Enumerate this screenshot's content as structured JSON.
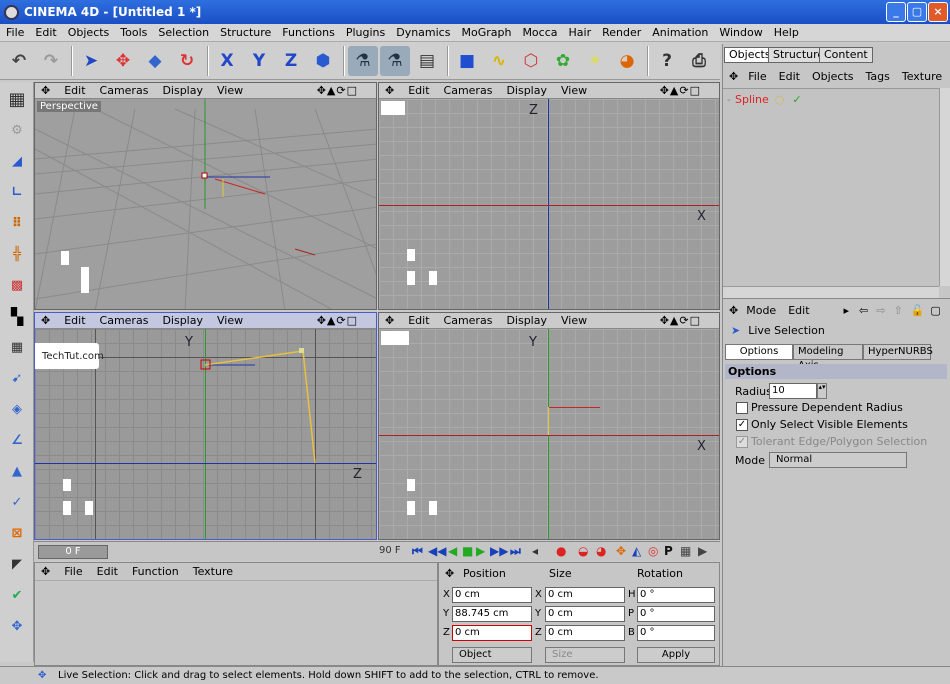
{
  "window": {
    "title": "CINEMA 4D - [Untitled 1 *]",
    "minimize": "_",
    "maximize": "▢",
    "close": "×"
  },
  "menu": [
    "File",
    "Edit",
    "Objects",
    "Tools",
    "Selection",
    "Structure",
    "Functions",
    "Plugins",
    "Dynamics",
    "MoGraph",
    "Mocca",
    "Hair",
    "Render",
    "Animation",
    "Window",
    "Help"
  ],
  "viewport_menu": {
    "edit": "Edit",
    "cameras": "Cameras",
    "display": "Display",
    "view": "View",
    "controls": "✥▲⟳□"
  },
  "viewports": {
    "perspective": {
      "label": "Perspective"
    },
    "top_right": {
      "axis_v": "Z",
      "axis_h": "X"
    },
    "bottom_left": {
      "axis_v": "Y",
      "axis_h": "Z"
    },
    "bottom_right": {
      "axis_v": "Y",
      "axis_h": "X"
    }
  },
  "watermark": "TechTut.com",
  "toolbar_icons": [
    "undo-icon",
    "redo-icon",
    "select-arrow-icon",
    "move-icon",
    "scale-icon",
    "rotate-icon",
    "x-axis-icon",
    "y-axis-icon",
    "z-axis-icon",
    "coordinate-system-icon",
    "model-mode-icon",
    "object-mode-icon",
    "render-settings-icon",
    "cube-icon",
    "spline-icon",
    "nurbs-icon",
    "array-icon",
    "deformer-icon",
    "scene-icon",
    "help-icon",
    "camera-icon"
  ],
  "toolbar_labels": {
    "x": "X",
    "y": "Y",
    "z": "Z"
  },
  "left_tools": [
    "viewport-layout-icon",
    "object-mode-icon",
    "axis-mode-icon",
    "model-mode-icon",
    "points-mode-icon",
    "edges-mode-icon",
    "polygons-mode-icon",
    "texture-mode-icon",
    "workplane-icon",
    "live-select-icon",
    "box-select-icon",
    "freehand-select-icon",
    "polygon-select-icon",
    "brush-icon",
    "magnet-icon",
    "knife-icon",
    "iron-icon",
    "move-tool-icon"
  ],
  "timeline": {
    "start": "0 F",
    "end": "90 F",
    "buttons": "⏮◀◀▶▶⏭"
  },
  "material_menu": [
    "File",
    "Edit",
    "Function",
    "Texture"
  ],
  "coordinates": {
    "headers": {
      "position": "Position",
      "size": "Size",
      "rotation": "Rotation"
    },
    "labels": {
      "x": "X",
      "y": "Y",
      "z": "Z",
      "h": "H",
      "p": "P",
      "b": "B"
    },
    "pos": {
      "x": "0 cm",
      "y": "88.745 cm",
      "z": "0 cm"
    },
    "size": {
      "x": "0 cm",
      "y": "0 cm",
      "z": "0 cm"
    },
    "rot": {
      "h": "0 °",
      "p": "0 °",
      "b": "0 °"
    },
    "mode": "Object",
    "size_mode": "Size",
    "apply": "Apply"
  },
  "objects_panel": {
    "tabs": [
      "Objects",
      "Structure",
      "Content"
    ],
    "menu": [
      "File",
      "Edit",
      "Objects",
      "Tags",
      "Texture"
    ],
    "items": [
      {
        "name": "Spline"
      }
    ]
  },
  "attributes": {
    "menu": {
      "mode": "Mode",
      "edit": "Edit"
    },
    "tool_name": "Live Selection",
    "tabs": [
      "Options",
      "Modeling Axis",
      "HyperNURBS"
    ],
    "section": "Options",
    "radius_label": "Radius",
    "radius_value": "10",
    "options": [
      {
        "label": "Pressure Dependent Radius",
        "checked": false,
        "disabled": false
      },
      {
        "label": "Only Select Visible Elements",
        "checked": true,
        "disabled": false
      },
      {
        "label": "Tolerant Edge/Polygon Selection",
        "checked": true,
        "disabled": true
      }
    ],
    "mode_label": "Mode",
    "mode_value": "Normal"
  },
  "status": "Live Selection: Click and drag to select elements. Hold down SHIFT to add to the selection, CTRL to remove."
}
